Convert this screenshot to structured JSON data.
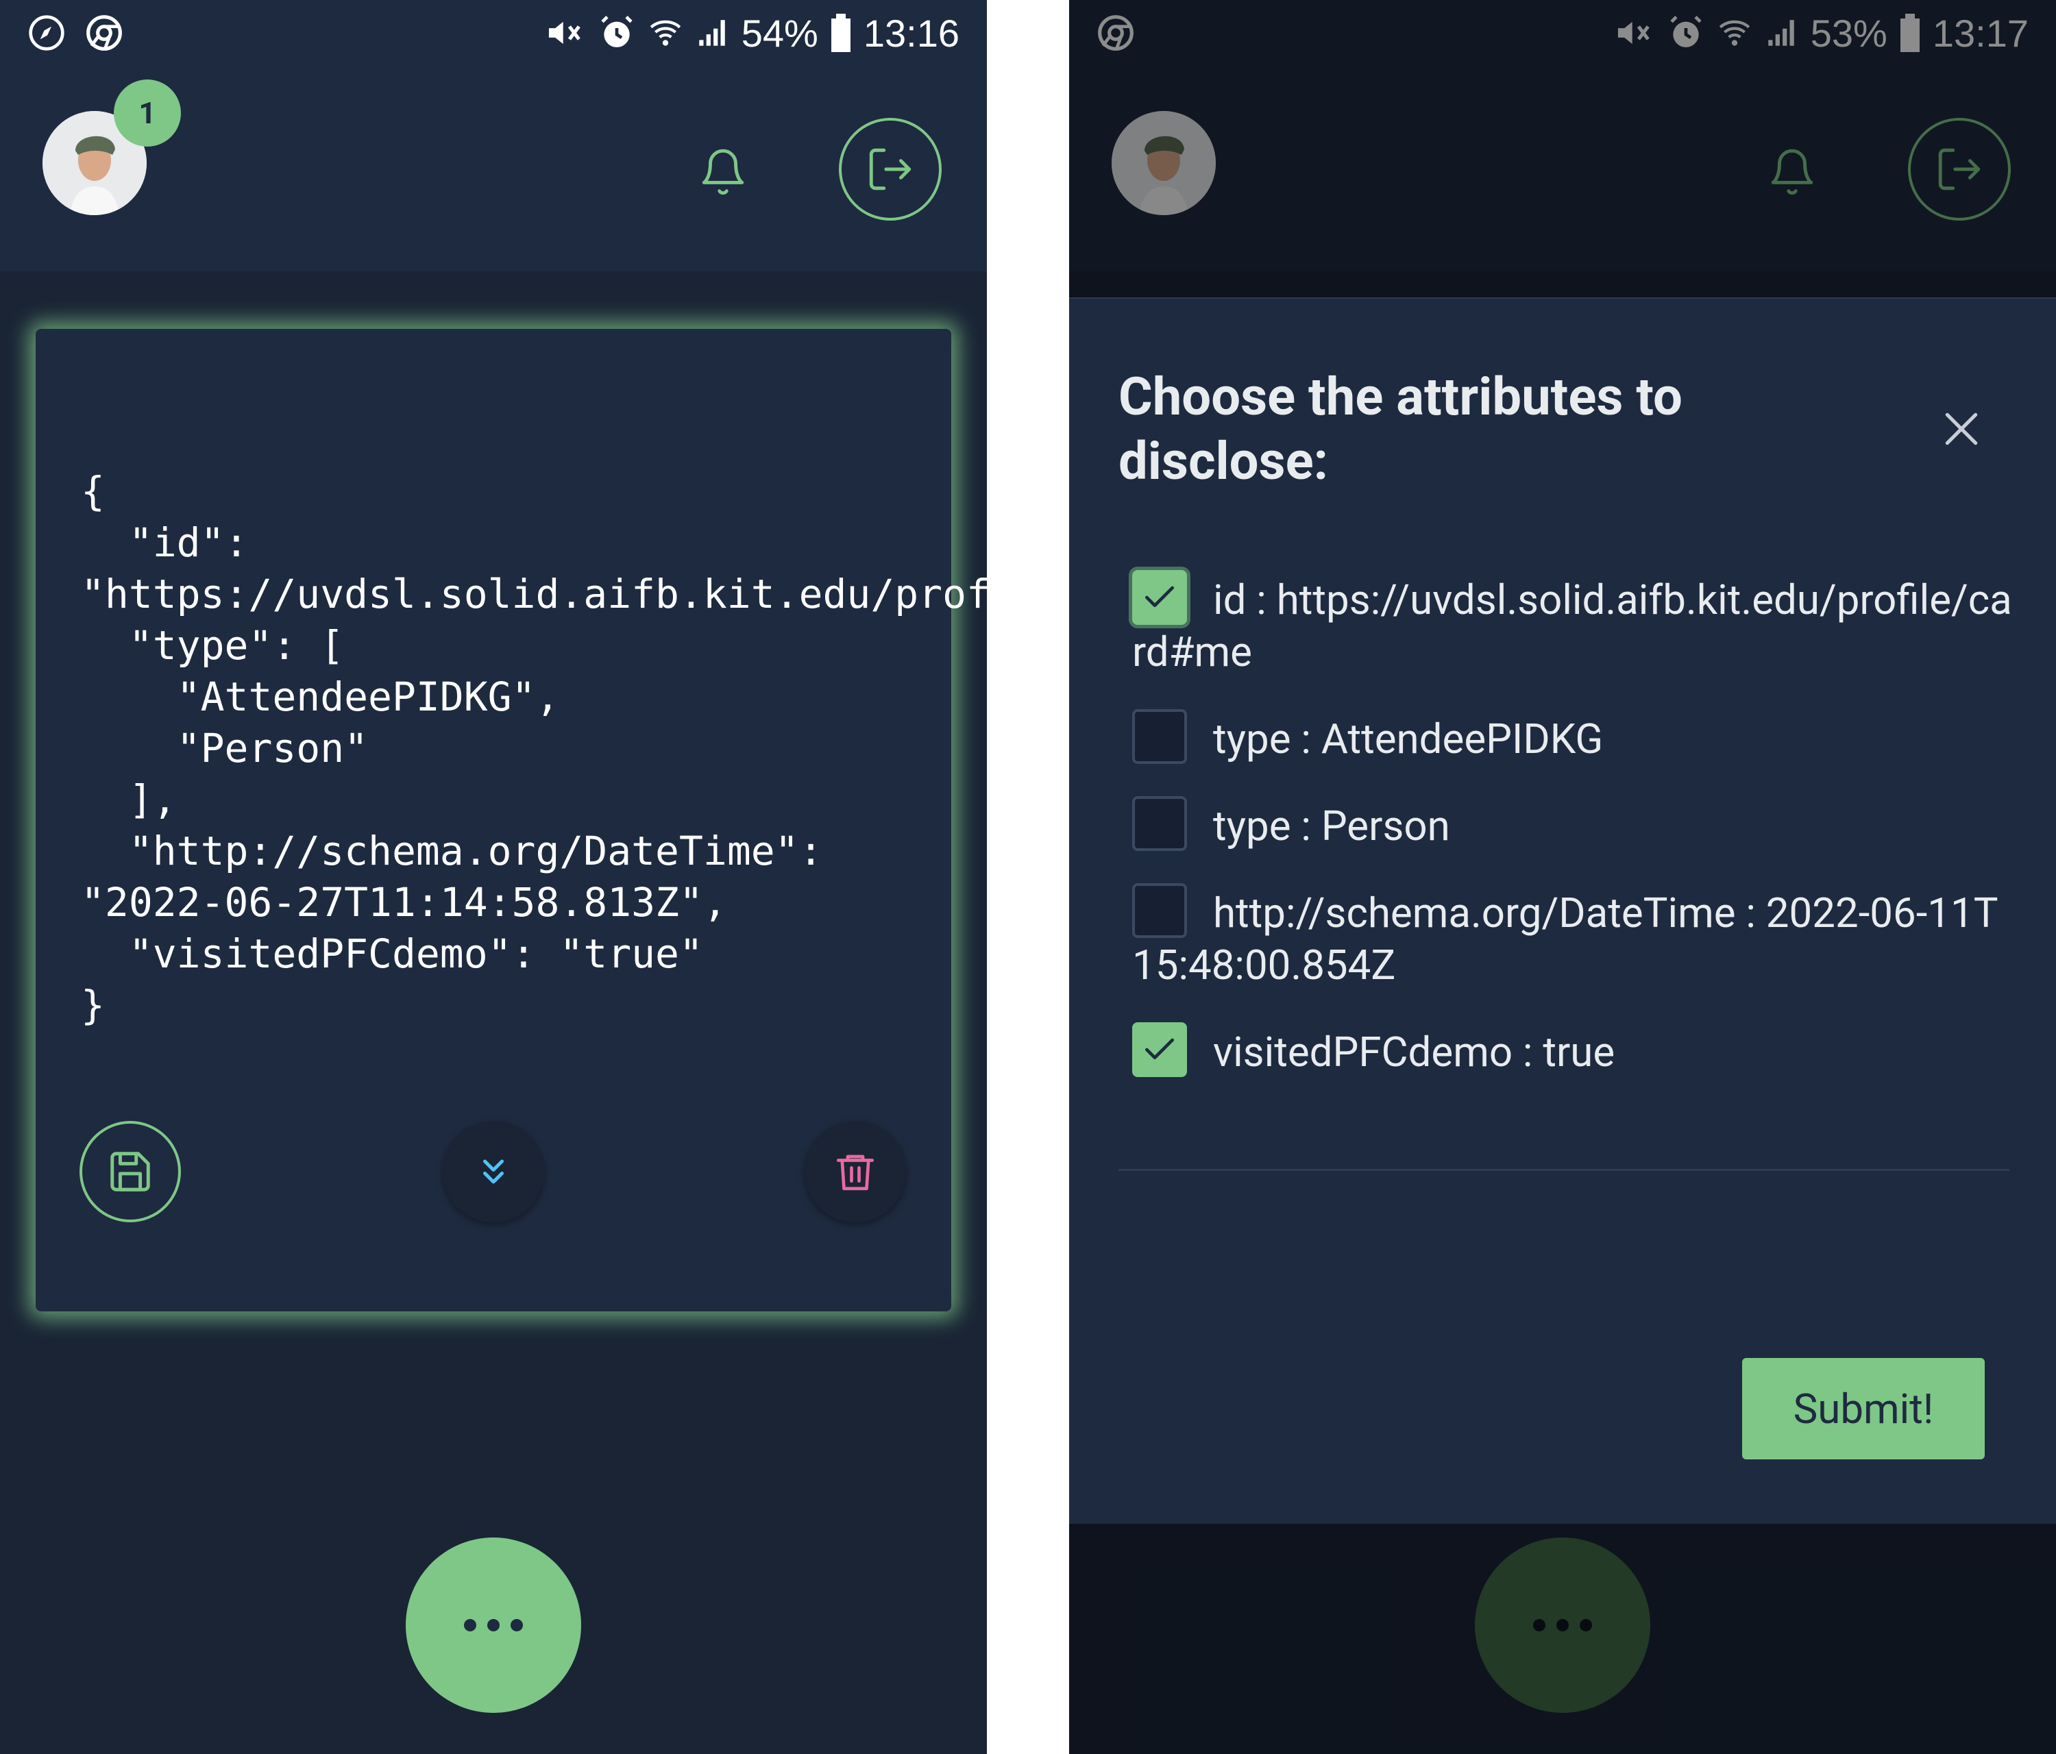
{
  "left_screen": {
    "status_bar": {
      "battery": "54%",
      "time": "13:16"
    },
    "header": {
      "notification_count": "1"
    },
    "credential_json": "{\n  \"id\": \"https://uvdsl.solid.aifb.kit.edu/profile/card#me\",\n  \"type\": [\n    \"AttendeePIDKG\",\n    \"Person\"\n  ],\n  \"http://schema.org/DateTime\": \"2022-06-27T11:14:58.813Z\",\n  \"visitedPFCdemo\": \"true\"\n}",
    "card_actions": {
      "save": "save-icon",
      "expand": "chevrons-down-icon",
      "delete": "trash-icon"
    }
  },
  "right_screen": {
    "status_bar": {
      "battery": "53%",
      "time": "13:17"
    },
    "dialog": {
      "title": "Choose the attributes to disclose:",
      "attributes": [
        {
          "label": "id : https://uvdsl.solid.aifb.kit.edu/profile/card#me",
          "checked": true
        },
        {
          "label": "type : AttendeePIDKG",
          "checked": false
        },
        {
          "label": "type : Person",
          "checked": false
        },
        {
          "label": "http://schema.org/DateTime : 2022-06-11T15:48:00.854Z",
          "checked": false
        },
        {
          "label": "visitedPFCdemo : true",
          "checked": true
        }
      ],
      "submit_label": "Submit!"
    }
  },
  "colors": {
    "background": "#1a2435",
    "surface": "#1e2a3f",
    "accent_green": "#7ec787",
    "delete_pink": "#e86aa0",
    "expand_blue": "#4fc3f7"
  }
}
